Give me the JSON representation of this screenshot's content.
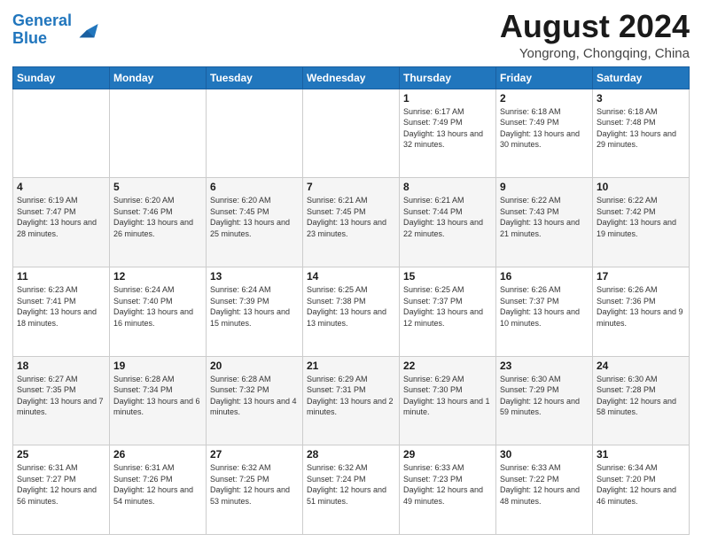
{
  "header": {
    "logo_line1": "General",
    "logo_line2": "Blue",
    "main_title": "August 2024",
    "sub_title": "Yongrong, Chongqing, China"
  },
  "weekdays": [
    "Sunday",
    "Monday",
    "Tuesday",
    "Wednesday",
    "Thursday",
    "Friday",
    "Saturday"
  ],
  "weeks": [
    [
      {
        "day": "",
        "info": ""
      },
      {
        "day": "",
        "info": ""
      },
      {
        "day": "",
        "info": ""
      },
      {
        "day": "",
        "info": ""
      },
      {
        "day": "1",
        "info": "Sunrise: 6:17 AM\nSunset: 7:49 PM\nDaylight: 13 hours and 32 minutes."
      },
      {
        "day": "2",
        "info": "Sunrise: 6:18 AM\nSunset: 7:49 PM\nDaylight: 13 hours and 30 minutes."
      },
      {
        "day": "3",
        "info": "Sunrise: 6:18 AM\nSunset: 7:48 PM\nDaylight: 13 hours and 29 minutes."
      }
    ],
    [
      {
        "day": "4",
        "info": "Sunrise: 6:19 AM\nSunset: 7:47 PM\nDaylight: 13 hours and 28 minutes."
      },
      {
        "day": "5",
        "info": "Sunrise: 6:20 AM\nSunset: 7:46 PM\nDaylight: 13 hours and 26 minutes."
      },
      {
        "day": "6",
        "info": "Sunrise: 6:20 AM\nSunset: 7:45 PM\nDaylight: 13 hours and 25 minutes."
      },
      {
        "day": "7",
        "info": "Sunrise: 6:21 AM\nSunset: 7:45 PM\nDaylight: 13 hours and 23 minutes."
      },
      {
        "day": "8",
        "info": "Sunrise: 6:21 AM\nSunset: 7:44 PM\nDaylight: 13 hours and 22 minutes."
      },
      {
        "day": "9",
        "info": "Sunrise: 6:22 AM\nSunset: 7:43 PM\nDaylight: 13 hours and 21 minutes."
      },
      {
        "day": "10",
        "info": "Sunrise: 6:22 AM\nSunset: 7:42 PM\nDaylight: 13 hours and 19 minutes."
      }
    ],
    [
      {
        "day": "11",
        "info": "Sunrise: 6:23 AM\nSunset: 7:41 PM\nDaylight: 13 hours and 18 minutes."
      },
      {
        "day": "12",
        "info": "Sunrise: 6:24 AM\nSunset: 7:40 PM\nDaylight: 13 hours and 16 minutes."
      },
      {
        "day": "13",
        "info": "Sunrise: 6:24 AM\nSunset: 7:39 PM\nDaylight: 13 hours and 15 minutes."
      },
      {
        "day": "14",
        "info": "Sunrise: 6:25 AM\nSunset: 7:38 PM\nDaylight: 13 hours and 13 minutes."
      },
      {
        "day": "15",
        "info": "Sunrise: 6:25 AM\nSunset: 7:37 PM\nDaylight: 13 hours and 12 minutes."
      },
      {
        "day": "16",
        "info": "Sunrise: 6:26 AM\nSunset: 7:37 PM\nDaylight: 13 hours and 10 minutes."
      },
      {
        "day": "17",
        "info": "Sunrise: 6:26 AM\nSunset: 7:36 PM\nDaylight: 13 hours and 9 minutes."
      }
    ],
    [
      {
        "day": "18",
        "info": "Sunrise: 6:27 AM\nSunset: 7:35 PM\nDaylight: 13 hours and 7 minutes."
      },
      {
        "day": "19",
        "info": "Sunrise: 6:28 AM\nSunset: 7:34 PM\nDaylight: 13 hours and 6 minutes."
      },
      {
        "day": "20",
        "info": "Sunrise: 6:28 AM\nSunset: 7:32 PM\nDaylight: 13 hours and 4 minutes."
      },
      {
        "day": "21",
        "info": "Sunrise: 6:29 AM\nSunset: 7:31 PM\nDaylight: 13 hours and 2 minutes."
      },
      {
        "day": "22",
        "info": "Sunrise: 6:29 AM\nSunset: 7:30 PM\nDaylight: 13 hours and 1 minute."
      },
      {
        "day": "23",
        "info": "Sunrise: 6:30 AM\nSunset: 7:29 PM\nDaylight: 12 hours and 59 minutes."
      },
      {
        "day": "24",
        "info": "Sunrise: 6:30 AM\nSunset: 7:28 PM\nDaylight: 12 hours and 58 minutes."
      }
    ],
    [
      {
        "day": "25",
        "info": "Sunrise: 6:31 AM\nSunset: 7:27 PM\nDaylight: 12 hours and 56 minutes."
      },
      {
        "day": "26",
        "info": "Sunrise: 6:31 AM\nSunset: 7:26 PM\nDaylight: 12 hours and 54 minutes."
      },
      {
        "day": "27",
        "info": "Sunrise: 6:32 AM\nSunset: 7:25 PM\nDaylight: 12 hours and 53 minutes."
      },
      {
        "day": "28",
        "info": "Sunrise: 6:32 AM\nSunset: 7:24 PM\nDaylight: 12 hours and 51 minutes."
      },
      {
        "day": "29",
        "info": "Sunrise: 6:33 AM\nSunset: 7:23 PM\nDaylight: 12 hours and 49 minutes."
      },
      {
        "day": "30",
        "info": "Sunrise: 6:33 AM\nSunset: 7:22 PM\nDaylight: 12 hours and 48 minutes."
      },
      {
        "day": "31",
        "info": "Sunrise: 6:34 AM\nSunset: 7:20 PM\nDaylight: 12 hours and 46 minutes."
      }
    ]
  ]
}
